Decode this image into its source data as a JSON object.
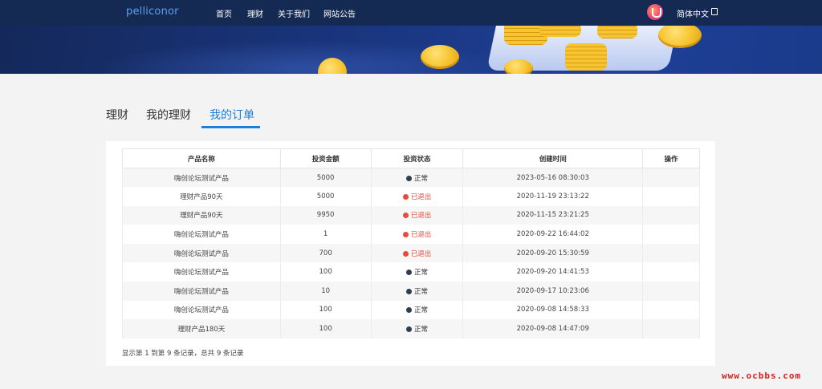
{
  "header": {
    "brand": "pelliconor",
    "nav": [
      "首页",
      "理财",
      "关于我们",
      "网站公告"
    ],
    "language": "简体中文"
  },
  "tabs": [
    {
      "label": "理财",
      "active": false
    },
    {
      "label": "我的理财",
      "active": false
    },
    {
      "label": "我的订单",
      "active": true
    }
  ],
  "table": {
    "columns": [
      "产品名称",
      "投资金额",
      "投资状态",
      "创建时间",
      "操作"
    ],
    "rows": [
      {
        "name": "嗨创论坛测试产品",
        "amount": "5000",
        "status": "正常",
        "status_type": "normal",
        "created": "2023-05-16 08:30:03",
        "action": ""
      },
      {
        "name": "理财产品90天",
        "amount": "5000",
        "status": "已退出",
        "status_type": "exit",
        "created": "2020-11-19 23:13:22",
        "action": ""
      },
      {
        "name": "理财产品90天",
        "amount": "9950",
        "status": "已退出",
        "status_type": "exit",
        "created": "2020-11-15 23:21:25",
        "action": ""
      },
      {
        "name": "嗨创论坛测试产品",
        "amount": "1",
        "status": "已退出",
        "status_type": "exit",
        "created": "2020-09-22 16:44:02",
        "action": ""
      },
      {
        "name": "嗨创论坛测试产品",
        "amount": "700",
        "status": "已退出",
        "status_type": "exit",
        "created": "2020-09-20 15:30:59",
        "action": ""
      },
      {
        "name": "嗨创论坛测试产品",
        "amount": "100",
        "status": "正常",
        "status_type": "normal",
        "created": "2020-09-20 14:41:53",
        "action": ""
      },
      {
        "name": "嗨创论坛测试产品",
        "amount": "10",
        "status": "正常",
        "status_type": "normal",
        "created": "2020-09-17 10:23:06",
        "action": ""
      },
      {
        "name": "嗨创论坛测试产品",
        "amount": "100",
        "status": "正常",
        "status_type": "normal",
        "created": "2020-09-08 14:58:33",
        "action": ""
      },
      {
        "name": "理财产品180天",
        "amount": "100",
        "status": "正常",
        "status_type": "normal",
        "created": "2020-09-08 14:47:09",
        "action": ""
      }
    ],
    "summary": "显示第 1 到第 9 条记录，总共 9 条记录"
  },
  "colors": {
    "navbar": "#142a52",
    "accent": "#1c7ee0",
    "status_normal": "#2c3e50",
    "status_exit": "#e74c3c"
  },
  "watermark": "www.ocbbs.com"
}
